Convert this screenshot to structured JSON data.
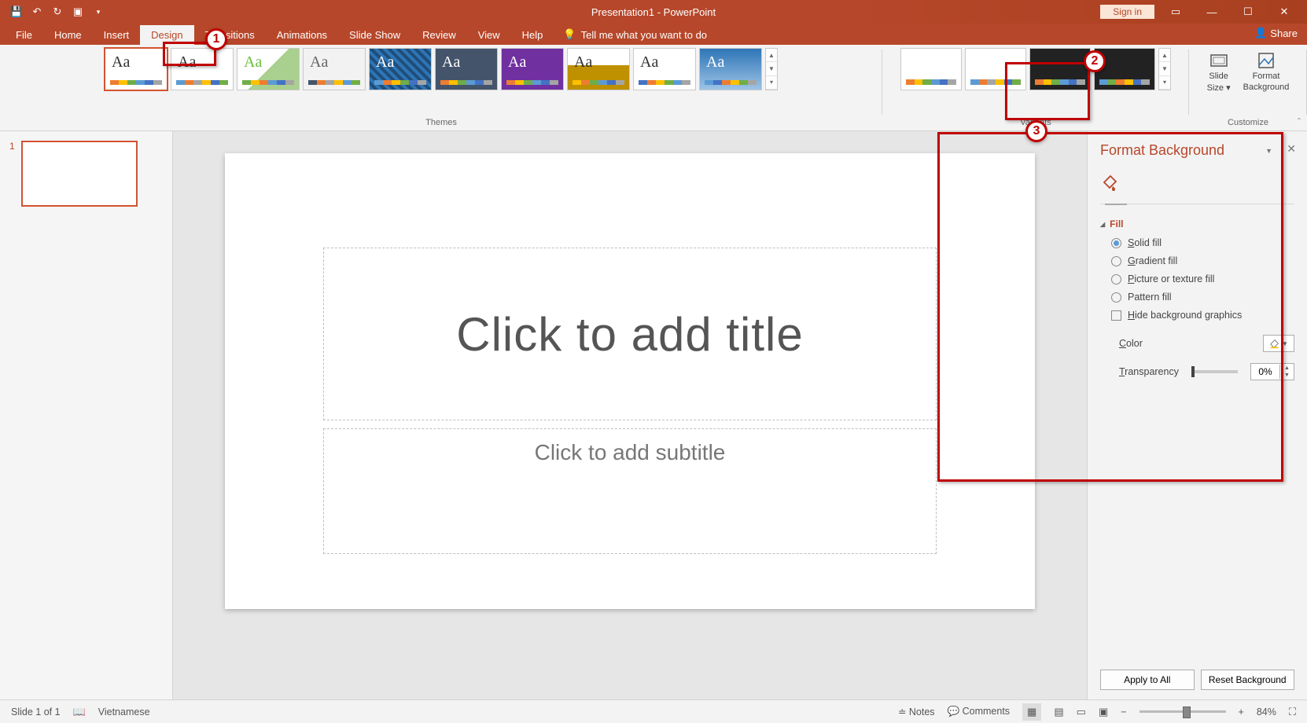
{
  "titlebar": {
    "app_title": "Presentation1 - PowerPoint",
    "signin": "Sign in"
  },
  "tabs": {
    "file": "File",
    "home": "Home",
    "insert": "Insert",
    "design": "Design",
    "transitions": "Transitions",
    "animations": "Animations",
    "slideshow": "Slide Show",
    "review": "Review",
    "view": "View",
    "help": "Help",
    "tellme": "Tell me what you want to do",
    "share": "Share"
  },
  "ribbon": {
    "themes_label": "Themes",
    "variants_label": "Variants",
    "customize_label": "Customize",
    "slide_size": "Slide",
    "slide_size2": "Size",
    "format_bg": "Format",
    "format_bg2": "Background"
  },
  "slide": {
    "title_ph": "Click to add title",
    "subtitle_ph": "Click to add subtitle",
    "thumb_num": "1"
  },
  "pane": {
    "title": "Format Background",
    "fill": "Fill",
    "solid": "olid fill",
    "gradient": "radient fill",
    "picture": "icture or texture fill",
    "pattern": "Pattern fill",
    "hide": "ide background graphics",
    "color": "olor",
    "transparency": "ransparency",
    "trans_val": "0%",
    "apply": "Apply to All",
    "reset": "Reset Background"
  },
  "status": {
    "slide_of": "Slide 1 of 1",
    "lang": "Vietnamese",
    "notes": "Notes",
    "comments": "Comments",
    "zoom": "84%"
  },
  "callouts": {
    "c1": "1",
    "c2": "2",
    "c3": "3"
  }
}
